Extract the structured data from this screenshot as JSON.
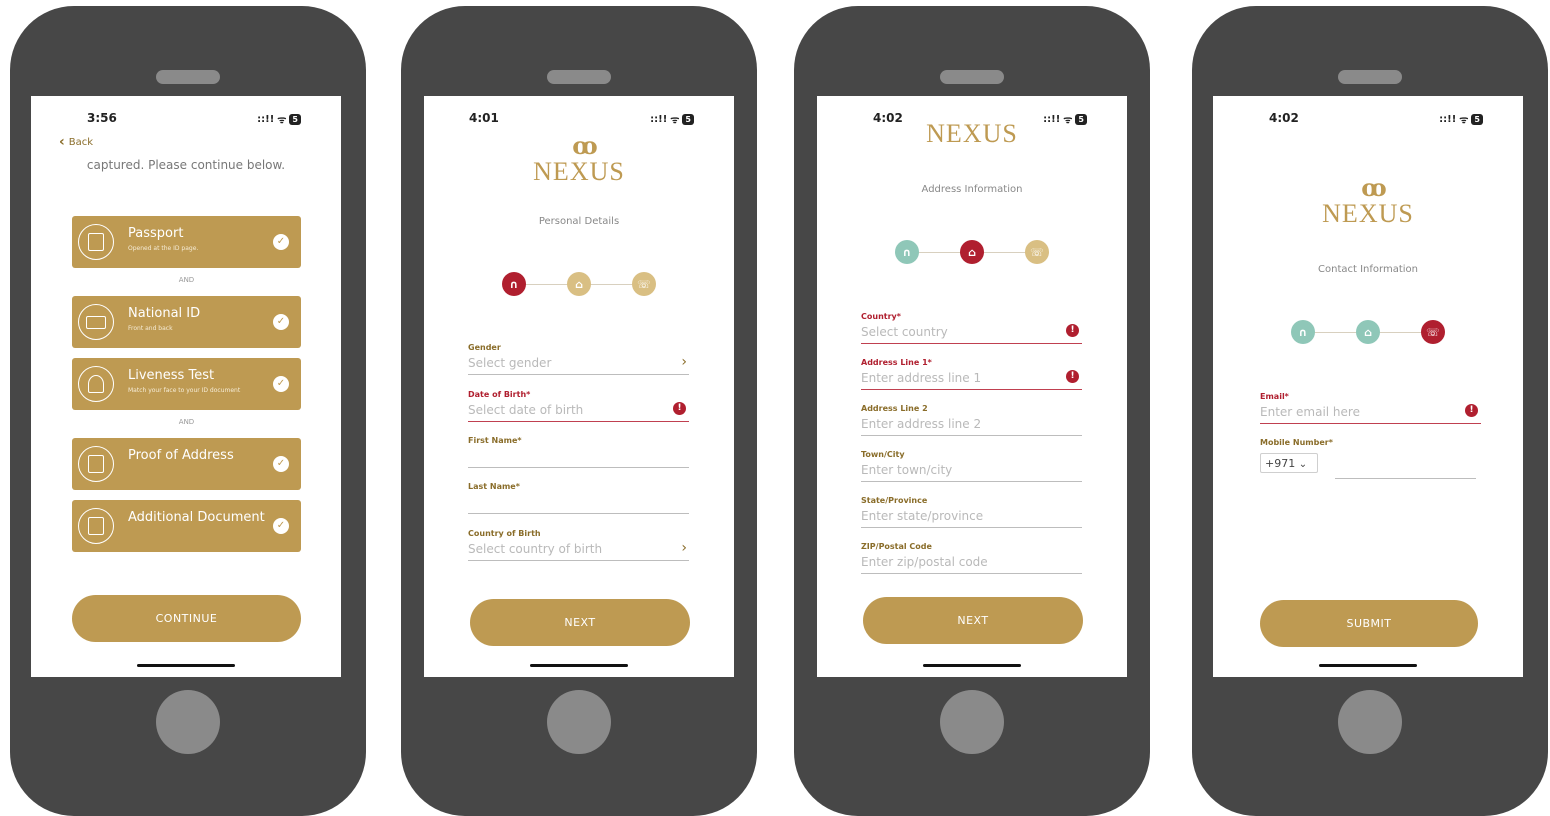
{
  "status": {
    "p1_time": "3:56",
    "p2_time": "4:01",
    "p3_time": "4:02",
    "p4_time": "4:02",
    "signal": "::!!",
    "wifi": "ᯤ",
    "battery": "5"
  },
  "phone1": {
    "back_label": "Back",
    "captured_text": "captured. Please continue below.",
    "cards": [
      {
        "title": "Passport",
        "sub": "Opened at the ID page."
      },
      {
        "title": "National ID",
        "sub": "Front and back"
      },
      {
        "title": "Liveness Test",
        "sub": "Match your face to your ID document"
      },
      {
        "title": "Proof of Address",
        "sub": ""
      },
      {
        "title": "Additional Document",
        "sub": ""
      }
    ],
    "and_text": "AND",
    "continue_label": "CONTINUE"
  },
  "logo": {
    "rings": "ꝏ",
    "word": "NEXUS"
  },
  "phone2": {
    "section_title": "Personal Details",
    "fields": [
      {
        "label": "Gender",
        "placeholder": "Select gender"
      },
      {
        "label": "Date of Birth*",
        "placeholder": "Select date of birth"
      },
      {
        "label": "First Name*",
        "placeholder": ""
      },
      {
        "label": "Last Name*",
        "placeholder": ""
      },
      {
        "label": "Country of Birth",
        "placeholder": "Select country of birth"
      }
    ],
    "next_label": "NEXT"
  },
  "phone3": {
    "section_title": "Address Information",
    "fields": [
      {
        "label": "Country*",
        "placeholder": "Select country"
      },
      {
        "label": "Address Line 1*",
        "placeholder": "Enter address line 1"
      },
      {
        "label": "Address Line 2",
        "placeholder": "Enter address line 2"
      },
      {
        "label": "Town/City",
        "placeholder": "Enter town/city"
      },
      {
        "label": "State/Province",
        "placeholder": "Enter state/province"
      },
      {
        "label": "ZIP/Postal Code",
        "placeholder": "Enter zip/postal code"
      }
    ],
    "next_label": "NEXT"
  },
  "phone4": {
    "section_title": "Contact Information",
    "email_label": "Email*",
    "email_placeholder": "Enter email here",
    "mobile_label": "Mobile Number*",
    "country_code": "+971",
    "submit_label": "SUBMIT"
  },
  "colors": {
    "gold": "#be9a52",
    "error": "#b01f2f",
    "step_done": "#8fc7b8",
    "step_pending": "#d9bf83",
    "step_active": "#b01f2f"
  }
}
